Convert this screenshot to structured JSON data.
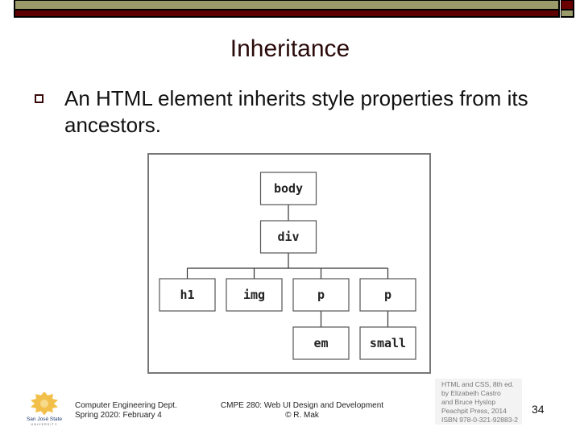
{
  "slide": {
    "title": "Inheritance",
    "bullets": [
      {
        "icon": "hollow-square-bullet-icon",
        "text": "An HTML element inherits style properties from its ancestors."
      }
    ]
  },
  "diagram": {
    "nodes": [
      {
        "id": "body",
        "label": "body",
        "level": 0,
        "parent": null
      },
      {
        "id": "div",
        "label": "div",
        "level": 1,
        "parent": "body"
      },
      {
        "id": "h1",
        "label": "h1",
        "level": 2,
        "parent": "div"
      },
      {
        "id": "img",
        "label": "img",
        "level": 2,
        "parent": "div"
      },
      {
        "id": "p1",
        "label": "p",
        "level": 2,
        "parent": "div"
      },
      {
        "id": "p2",
        "label": "p",
        "level": 2,
        "parent": "div"
      },
      {
        "id": "em",
        "label": "em",
        "level": 3,
        "parent": "p1"
      },
      {
        "id": "small",
        "label": "small",
        "level": 3,
        "parent": "p2"
      }
    ]
  },
  "footer": {
    "logo": {
      "line1": "San José State",
      "line2": "UNIVERSITY"
    },
    "left": [
      "Computer Engineering Dept.",
      "Spring 2020: February 4"
    ],
    "center": [
      "CMPE 280: Web UI Design and Development",
      "© R. Mak"
    ],
    "reference": [
      "HTML and CSS, 8th ed.",
      "by Elizabeth Castro",
      "and Bruce Hyslop",
      "Peachpit Press, 2014",
      "ISBN 978-0-321-92883-2"
    ],
    "page_number": "34"
  },
  "colors": {
    "olive": "#9b9a6b",
    "maroon": "#5c0000",
    "title_text": "#2a0a0a"
  }
}
